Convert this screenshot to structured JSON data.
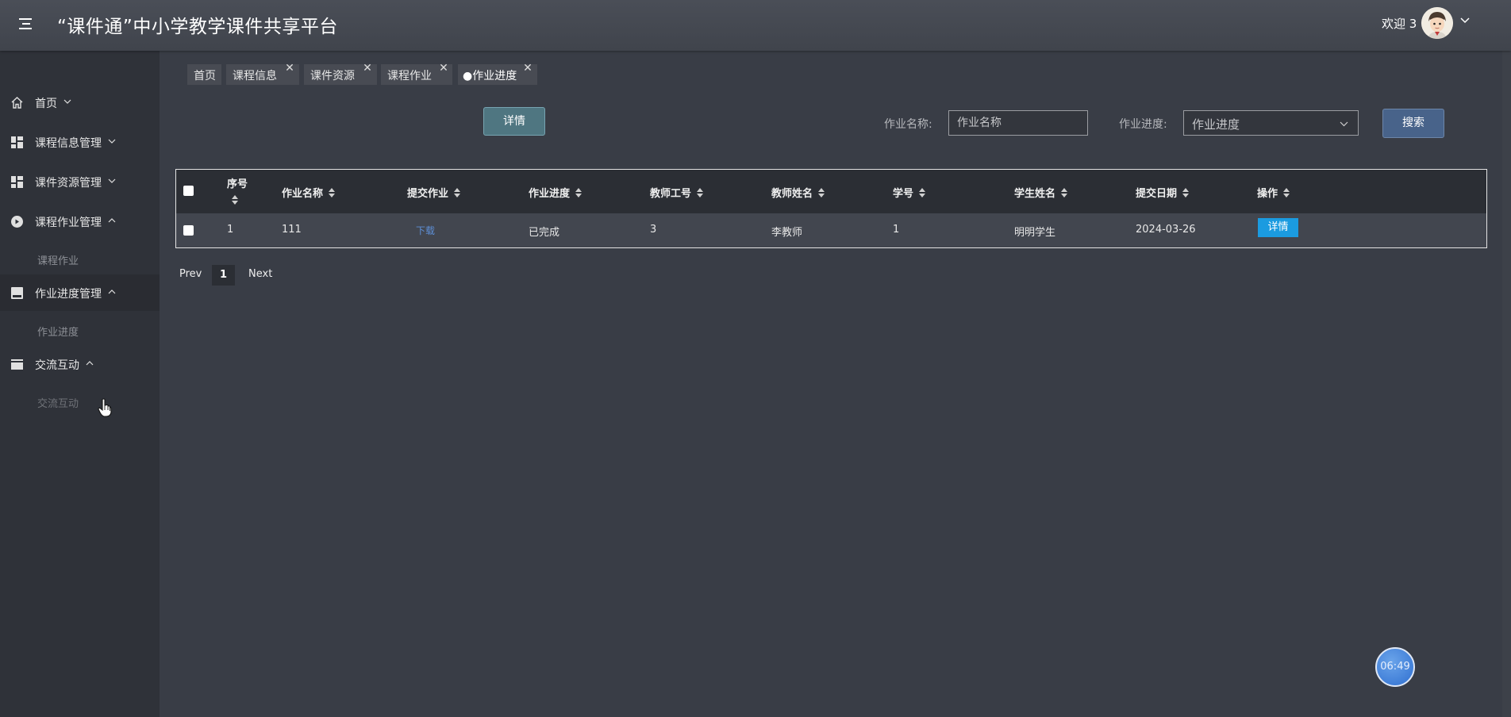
{
  "header": {
    "title": "“课件通”中小学教学课件共享平台",
    "welcome": "欢迎 3",
    "menu_icon": "hamburger-icon",
    "avatar_icon": "cartoon-avatar"
  },
  "sidebar": {
    "items": [
      {
        "label": "首页",
        "icon": "home-icon",
        "expanded": false
      },
      {
        "label": "课程信息管理",
        "icon": "dashboard-icon",
        "expanded": false
      },
      {
        "label": "课件资源管理",
        "icon": "dashboard-icon",
        "expanded": false
      },
      {
        "label": "课程作业管理",
        "icon": "circle-icon",
        "expanded": true,
        "sub": "课程作业"
      },
      {
        "label": "作业进度管理",
        "icon": "square-icon",
        "expanded": true,
        "sub": "作业进度"
      },
      {
        "label": "交流互动",
        "icon": "card-icon",
        "expanded": true,
        "sub": "交流互动"
      }
    ]
  },
  "tabs": [
    {
      "label": "首页",
      "closable": false
    },
    {
      "label": "课程信息",
      "closable": true
    },
    {
      "label": "课件资源",
      "closable": true
    },
    {
      "label": "课程作业",
      "closable": true
    },
    {
      "label": "●作业进度",
      "closable": true,
      "active": true
    }
  ],
  "toolbar": {
    "detail_label": "详情",
    "name_label": "作业名称:",
    "name_placeholder": "作业名称",
    "progress_label": "作业进度:",
    "progress_placeholder": "作业进度",
    "search_label": "搜索"
  },
  "table": {
    "columns": [
      "序号",
      "作业名称",
      "提交作业",
      "作业进度",
      "教师工号",
      "教师姓名",
      "学号",
      "学生姓名",
      "提交日期",
      "操作"
    ],
    "rows": [
      {
        "index": "1",
        "name": "111",
        "submission": "下载",
        "progress": "已完成",
        "teacher_id": "3",
        "teacher_name": "李教师",
        "student_id": "1",
        "student_name": "明明学生",
        "date": "2024-03-26",
        "action": "详情"
      }
    ]
  },
  "pagination": {
    "prev": "Prev",
    "current": "1",
    "next": "Next"
  },
  "clock": {
    "time": "06:49"
  },
  "colors": {
    "background": "#393d46",
    "sidebar": "#2f3239",
    "header": "#454951",
    "detail_button": "#4f7681",
    "search_button": "#48638a",
    "row_action": "#1b9be0",
    "link": "#5d8fd6"
  }
}
